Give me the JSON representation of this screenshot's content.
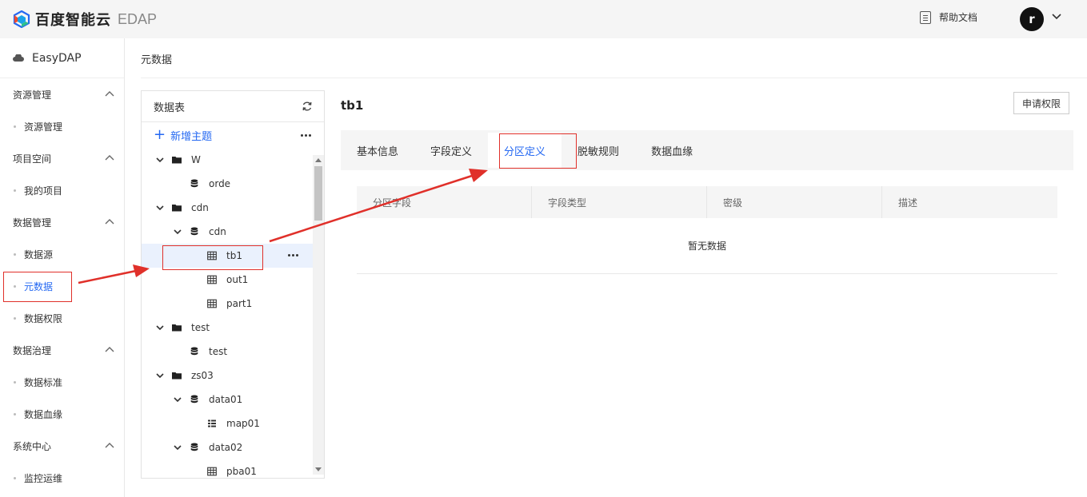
{
  "topbar": {
    "brand": "百度智能云",
    "product": "EDAP",
    "help_label": "帮助文档",
    "avatar_letter": "r"
  },
  "sidebar": {
    "head": "EasyDAP",
    "groups": [
      {
        "label": "资源管理",
        "items": [
          "资源管理"
        ]
      },
      {
        "label": "项目空间",
        "items": [
          "我的项目"
        ]
      },
      {
        "label": "数据管理",
        "items": [
          "数据源",
          "元数据",
          "数据权限"
        ]
      },
      {
        "label": "数据治理",
        "items": [
          "数据标准",
          "数据血缘"
        ]
      },
      {
        "label": "系统中心",
        "items": [
          "监控运维"
        ]
      }
    ],
    "active_item": "元数据"
  },
  "breadcrumb": "元数据",
  "tree": {
    "title": "数据表",
    "add_label": "新增主题",
    "nodes": [
      {
        "label": "W",
        "level": 0,
        "kind": "folder",
        "expanded": true
      },
      {
        "label": "orde",
        "level": 1,
        "kind": "db",
        "expanded": null
      },
      {
        "label": "cdn",
        "level": 0,
        "kind": "folder",
        "expanded": true
      },
      {
        "label": "cdn",
        "level": 1,
        "kind": "db",
        "expanded": true
      },
      {
        "label": "tb1",
        "level": 2,
        "kind": "table",
        "expanded": null,
        "selected": true
      },
      {
        "label": "out1",
        "level": 2,
        "kind": "table",
        "expanded": null
      },
      {
        "label": "part1",
        "level": 2,
        "kind": "table",
        "expanded": null
      },
      {
        "label": "test",
        "level": 0,
        "kind": "folder",
        "expanded": true
      },
      {
        "label": "test",
        "level": 1,
        "kind": "db",
        "expanded": null
      },
      {
        "label": "zs03",
        "level": 0,
        "kind": "folder",
        "expanded": true
      },
      {
        "label": "data01",
        "level": 1,
        "kind": "db",
        "expanded": true
      },
      {
        "label": "map01",
        "level": 2,
        "kind": "map",
        "expanded": null
      },
      {
        "label": "data02",
        "level": 1,
        "kind": "db",
        "expanded": true
      },
      {
        "label": "pba01",
        "level": 2,
        "kind": "table",
        "expanded": null
      }
    ]
  },
  "detail": {
    "title": "tb1",
    "apply_button": "申请权限",
    "tabs": [
      "基本信息",
      "字段定义",
      "分区定义",
      "脱敏规则",
      "数据血缘"
    ],
    "active_tab": "分区定义",
    "columns": [
      "分区字段",
      "字段类型",
      "密级",
      "描述"
    ],
    "empty_text": "暂无数据"
  },
  "colors": {
    "accent": "#2468f2",
    "annotation": "#e0302a"
  }
}
